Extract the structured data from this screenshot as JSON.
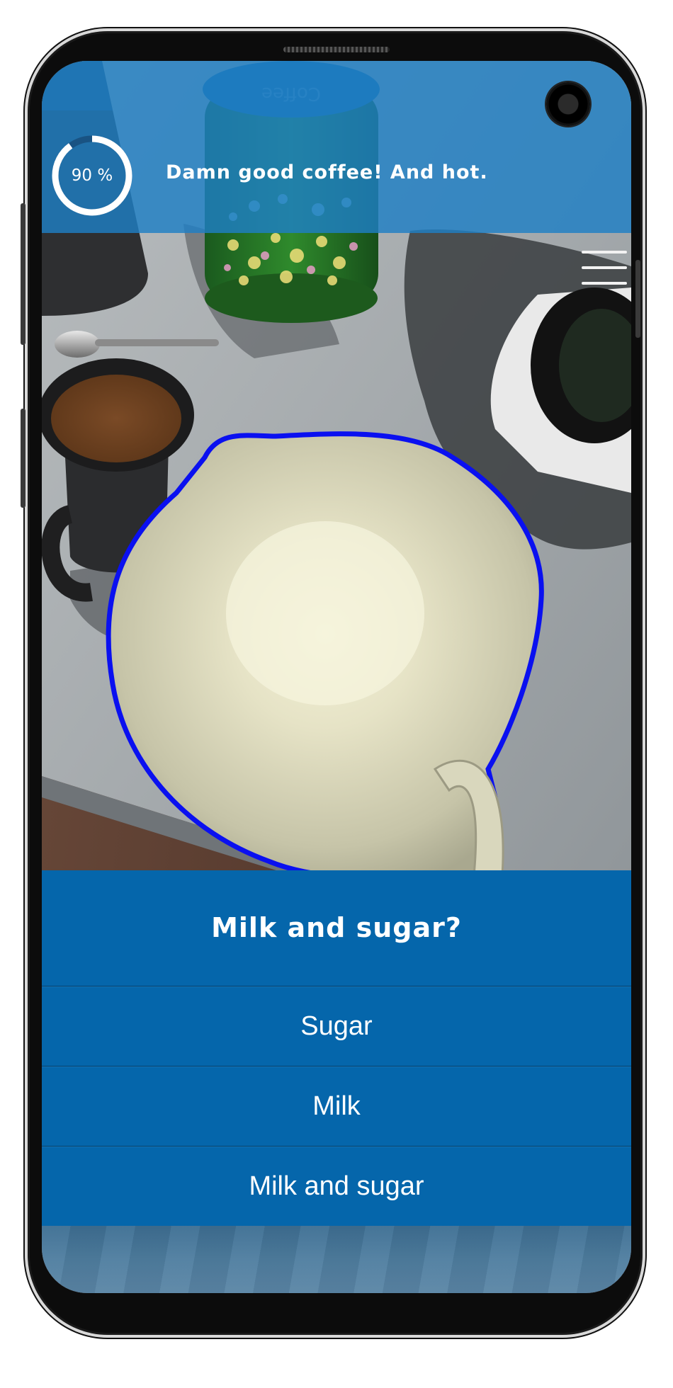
{
  "progress": {
    "value": 90,
    "label": "90 %"
  },
  "banner": {
    "message": "Damn good coffee! And hot."
  },
  "scene": {
    "canister_label": "Coffee"
  },
  "question": {
    "title": "Milk and sugar?",
    "options": [
      {
        "label": "Sugar"
      },
      {
        "label": "Milk"
      },
      {
        "label": "Milk and sugar"
      }
    ]
  },
  "colors": {
    "banner": "#1e7fc4",
    "dialog": "#0566ab",
    "highlight_outline": "#0a10f0",
    "text": "#ffffff"
  },
  "icons": {
    "menu": "hamburger-menu-icon",
    "camera": "front-camera-icon"
  }
}
